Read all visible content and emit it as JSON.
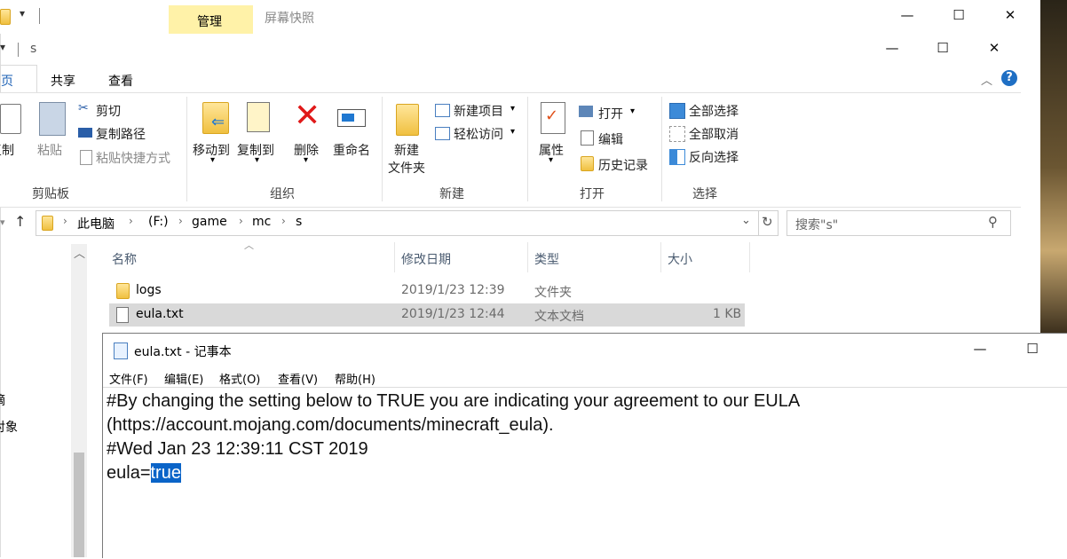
{
  "back_window": {
    "manage_tab": "管理",
    "title": "屏幕快照",
    "min": "—",
    "max": "☐",
    "close": "✕"
  },
  "explorer": {
    "title": "s",
    "min": "—",
    "max": "☐",
    "close": "✕",
    "tabs": [
      "主页",
      "共享",
      "查看"
    ],
    "clipboard": {
      "copy": "复制",
      "paste": "粘贴",
      "cut": "剪切",
      "copy_path": "复制路径",
      "paste_shortcut": "粘贴快捷方式",
      "group": "剪贴板"
    },
    "organize": {
      "move_to": "移动到",
      "copy_to": "复制到",
      "delete": "删除",
      "rename": "重命名",
      "group": "组织"
    },
    "new": {
      "new_folder_1": "新建",
      "new_folder_2": "文件夹",
      "new_item": "新建项目",
      "easy_access": "轻松访问",
      "group": "新建"
    },
    "open": {
      "properties": "属性",
      "open": "打开",
      "edit": "编辑",
      "history": "历史记录",
      "group": "打开"
    },
    "select": {
      "select_all": "全部选择",
      "select_none": "全部取消",
      "invert": "反向选择",
      "group": "选择"
    },
    "address": {
      "pc": "此电脑",
      "drive": "(F:)",
      "folder1": "game",
      "folder2": "mc",
      "folder3": "s"
    },
    "search_placeholder": "搜索\"s\"",
    "columns": {
      "name": "名称",
      "modified": "修改日期",
      "type": "类型",
      "size": "大小"
    },
    "files": [
      {
        "name": "logs",
        "modified": "2019/1/23 12:39",
        "type": "文件夹",
        "size": ""
      },
      {
        "name": "eula.txt",
        "modified": "2019/1/23 12:44",
        "type": "文本文档",
        "size": "1 KB"
      }
    ],
    "nav_fragments": [
      "摘",
      "对象"
    ]
  },
  "notepad": {
    "title": "eula.txt - 记事本",
    "menu": [
      "文件(F)",
      "编辑(E)",
      "格式(O)",
      "查看(V)",
      "帮助(H)"
    ],
    "lines": [
      "#By changing the setting below to TRUE you are indicating your agreement to our EULA",
      "(https://account.mojang.com/documents/minecraft_eula).",
      "#Wed Jan 23 12:39:11 CST 2019"
    ],
    "eula_key": "eula=",
    "eula_value": "true",
    "min": "—",
    "max": "☐"
  },
  "colors": {
    "accent": "#0a64c8",
    "manage_tab": "#fff2a8",
    "selection_row": "#d9d9d9"
  }
}
